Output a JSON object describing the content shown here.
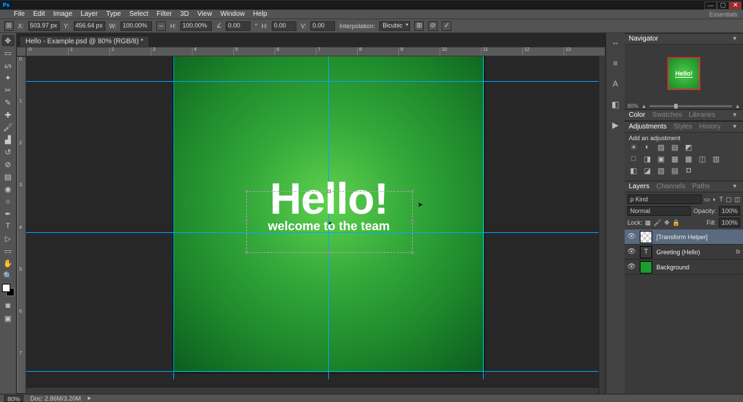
{
  "app_logo": "Ps",
  "menubar": {
    "items": [
      "File",
      "Edit",
      "Image",
      "Layer",
      "Type",
      "Select",
      "Filter",
      "3D",
      "View",
      "Window",
      "Help"
    ],
    "workspace": "Essentials"
  },
  "options": {
    "x_label": "X:",
    "x": "503.97 px",
    "y_label": "Y:",
    "y": "456.64 px",
    "w_label": "W:",
    "w": "100.00%",
    "h_label": "H:",
    "h": "100.00%",
    "angle_label": "∠",
    "angle": "0.00",
    "angle_unit": "°",
    "skew_h_label": "H:",
    "skew_h": "0.00",
    "skew_v_label": "V:",
    "skew_v": "0.00",
    "interp_label": "Interpolation:",
    "interp": "Bicubic",
    "link_icon": "⊞",
    "cancel_icon": "⊘",
    "commit_icon": "✓"
  },
  "tab": {
    "title": "Hello - Example.psd @ 80% (RGB/8) *"
  },
  "ruler": {
    "marks": [
      "0",
      "1",
      "2",
      "3",
      "4",
      "5",
      "6",
      "7",
      "8",
      "9",
      "10",
      "11",
      "12",
      "13"
    ]
  },
  "canvas": {
    "headline": "Hello!",
    "subhead": "welcome to the team"
  },
  "right_icons": [
    "⇔",
    "≡",
    "A",
    "◧",
    "▶"
  ],
  "panels": {
    "navigator": {
      "tab": "Navigator",
      "thumb_text": "Hello!"
    },
    "nav_slider": {
      "pct": "80%"
    },
    "color": {
      "tabs": [
        "Color",
        "Swatches",
        "Libraries"
      ]
    },
    "adjustments": {
      "tabs": [
        "Adjustments",
        "Styles",
        "History"
      ],
      "label": "Add an adjustment",
      "row1": [
        "☀",
        "◐",
        "▨",
        "▤",
        "◩"
      ],
      "row2": [
        "□",
        "◨",
        "▣",
        "▦",
        "▩",
        "◫",
        "▥"
      ],
      "row3": [
        "◧",
        "◪",
        "▧",
        "▤",
        "◘"
      ]
    },
    "layers_tabs": [
      "Layers",
      "Channels",
      "Paths"
    ],
    "layer_filter": {
      "kind": "ρ Kind",
      "icons": [
        "▭",
        "◐",
        "T",
        "▢",
        "◫"
      ]
    },
    "blend": {
      "mode": "Normal",
      "opacity_label": "Opacity:",
      "opacity": "100%",
      "fill_label": "Fill:",
      "fill": "100%",
      "lock_label": "Lock:"
    },
    "layers": [
      {
        "name": "[Transform Helper]",
        "type": "checker",
        "active": true,
        "fx": ""
      },
      {
        "name": "Greeting (Hello)",
        "type": "text",
        "active": false,
        "fx": "fx"
      },
      {
        "name": "Background",
        "type": "green",
        "active": false,
        "fx": ""
      }
    ]
  },
  "status": {
    "zoom": "80%",
    "doc": "Doc: 2.86M/3.20M",
    "arrow": "▸"
  }
}
